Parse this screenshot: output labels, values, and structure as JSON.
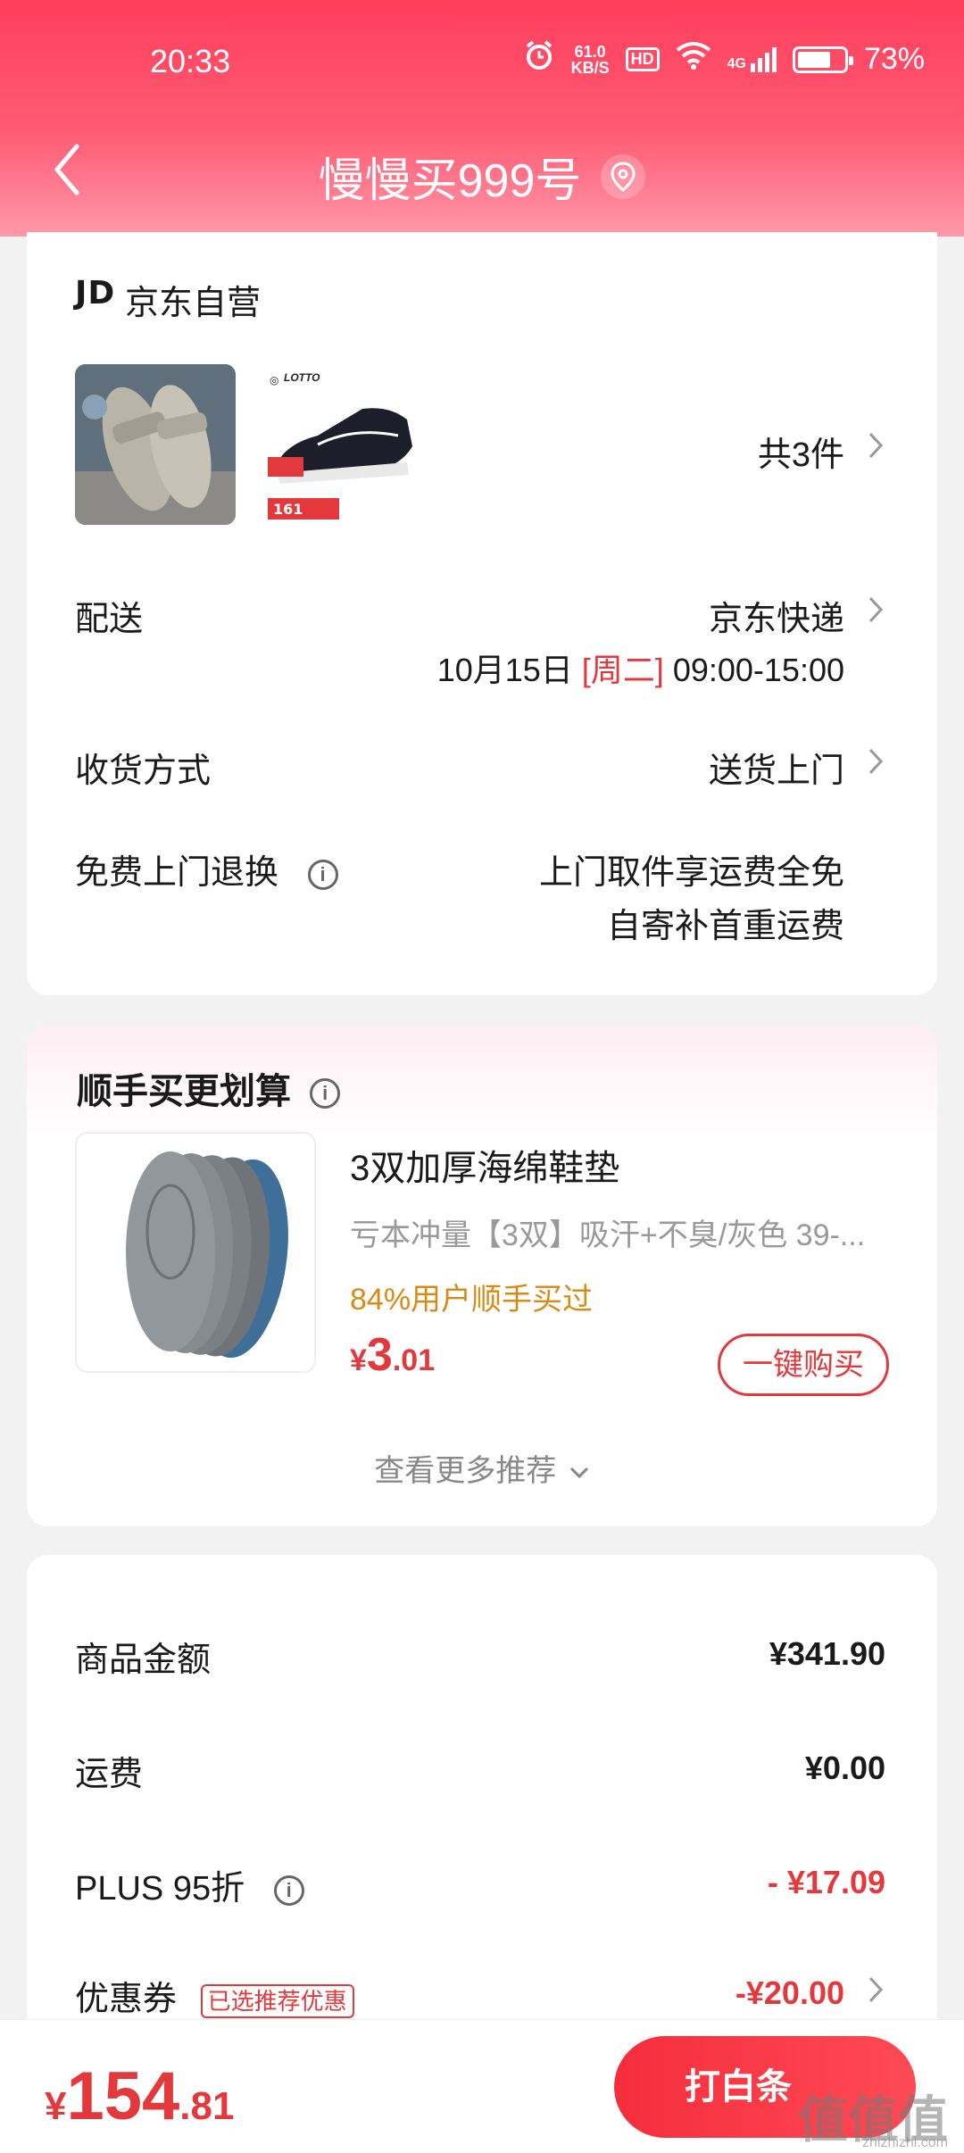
{
  "status_bar": {
    "time": "20:33",
    "net_speed_value": "61.0",
    "net_speed_unit": "KB/S",
    "hd": "HD",
    "signal": "4G",
    "battery": "73%",
    "battery_level": 0.73
  },
  "header": {
    "title": "慢慢买999号",
    "back_icon": "back-icon",
    "location_icon": "location-pin-icon"
  },
  "order": {
    "seller_logo": "JD",
    "seller_name": "京东自营",
    "items_count": "共3件",
    "delivery_label": "配送",
    "delivery_value": "京东快递",
    "delivery_date": "10月15日",
    "delivery_weekday": "[周二]",
    "delivery_time": "09:00-15:00",
    "receive_label": "收货方式",
    "receive_value": "送货上门",
    "return_label": "免费上门退换",
    "return_line1": "上门取件享运费全免",
    "return_line2": "自寄补首重运费",
    "product2_brand": "LOTTO",
    "product2_tag": "161"
  },
  "upsell": {
    "title": "顺手买更划算",
    "product_name": "3双加厚海绵鞋垫",
    "product_spec": "亏本冲量【3双】吸汗+不臭/灰色   39-...",
    "social_proof": "84%用户顺手买过",
    "price_symbol": "¥",
    "price_int": "3",
    "price_dec": ".01",
    "buy_label": "一键购买",
    "more_label": "查看更多推荐"
  },
  "summary": {
    "goods_label": "商品金额",
    "goods_value": "¥341.90",
    "shipping_label": "运费",
    "shipping_value": "¥0.00",
    "plus_label": "PLUS 95折",
    "plus_value": "- ¥17.09",
    "coupon_label": "优惠券",
    "coupon_tag": "已选推荐优惠",
    "coupon_value": "-¥20.00"
  },
  "bottom": {
    "total_symbol": "¥",
    "total_int": "154",
    "total_dec": ".81",
    "pay_label": "打白条",
    "watermark": "值值值",
    "watermark_sub": "zhizhizhi.com"
  },
  "colors": {
    "brand_red": "#e4393c",
    "header_top": "#ff3e5b",
    "orange_text": "#d88a14"
  }
}
